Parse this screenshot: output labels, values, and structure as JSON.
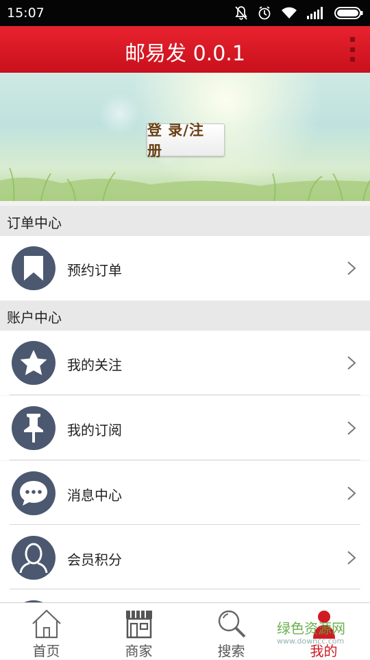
{
  "status_bar": {
    "time": "15:07"
  },
  "app_bar": {
    "title": "邮易发 0.0.1"
  },
  "banner": {
    "login_label": "登 录/注 册"
  },
  "sections": {
    "order": {
      "title": "订单中心",
      "items": [
        {
          "label": "预约订单",
          "icon": "bookmark-icon"
        }
      ]
    },
    "account": {
      "title": "账户中心",
      "items": [
        {
          "label": "我的关注",
          "icon": "star-icon"
        },
        {
          "label": "我的订阅",
          "icon": "pin-icon"
        },
        {
          "label": "消息中心",
          "icon": "chat-bubble-icon"
        },
        {
          "label": "会员积分",
          "icon": "user-icon"
        }
      ]
    }
  },
  "tab_bar": {
    "tabs": [
      {
        "label": "首页",
        "icon": "home-icon"
      },
      {
        "label": "商家",
        "icon": "store-icon"
      },
      {
        "label": "搜索",
        "icon": "search-icon"
      },
      {
        "label": "我的",
        "icon": "profile-icon",
        "active": true
      }
    ]
  },
  "watermark": {
    "text": "绿色资源网",
    "url": "www.downcc.com"
  },
  "colors": {
    "app_bar": "#d9161f",
    "icon_circle": "#4b5870",
    "active_tab": "#d01a24"
  }
}
